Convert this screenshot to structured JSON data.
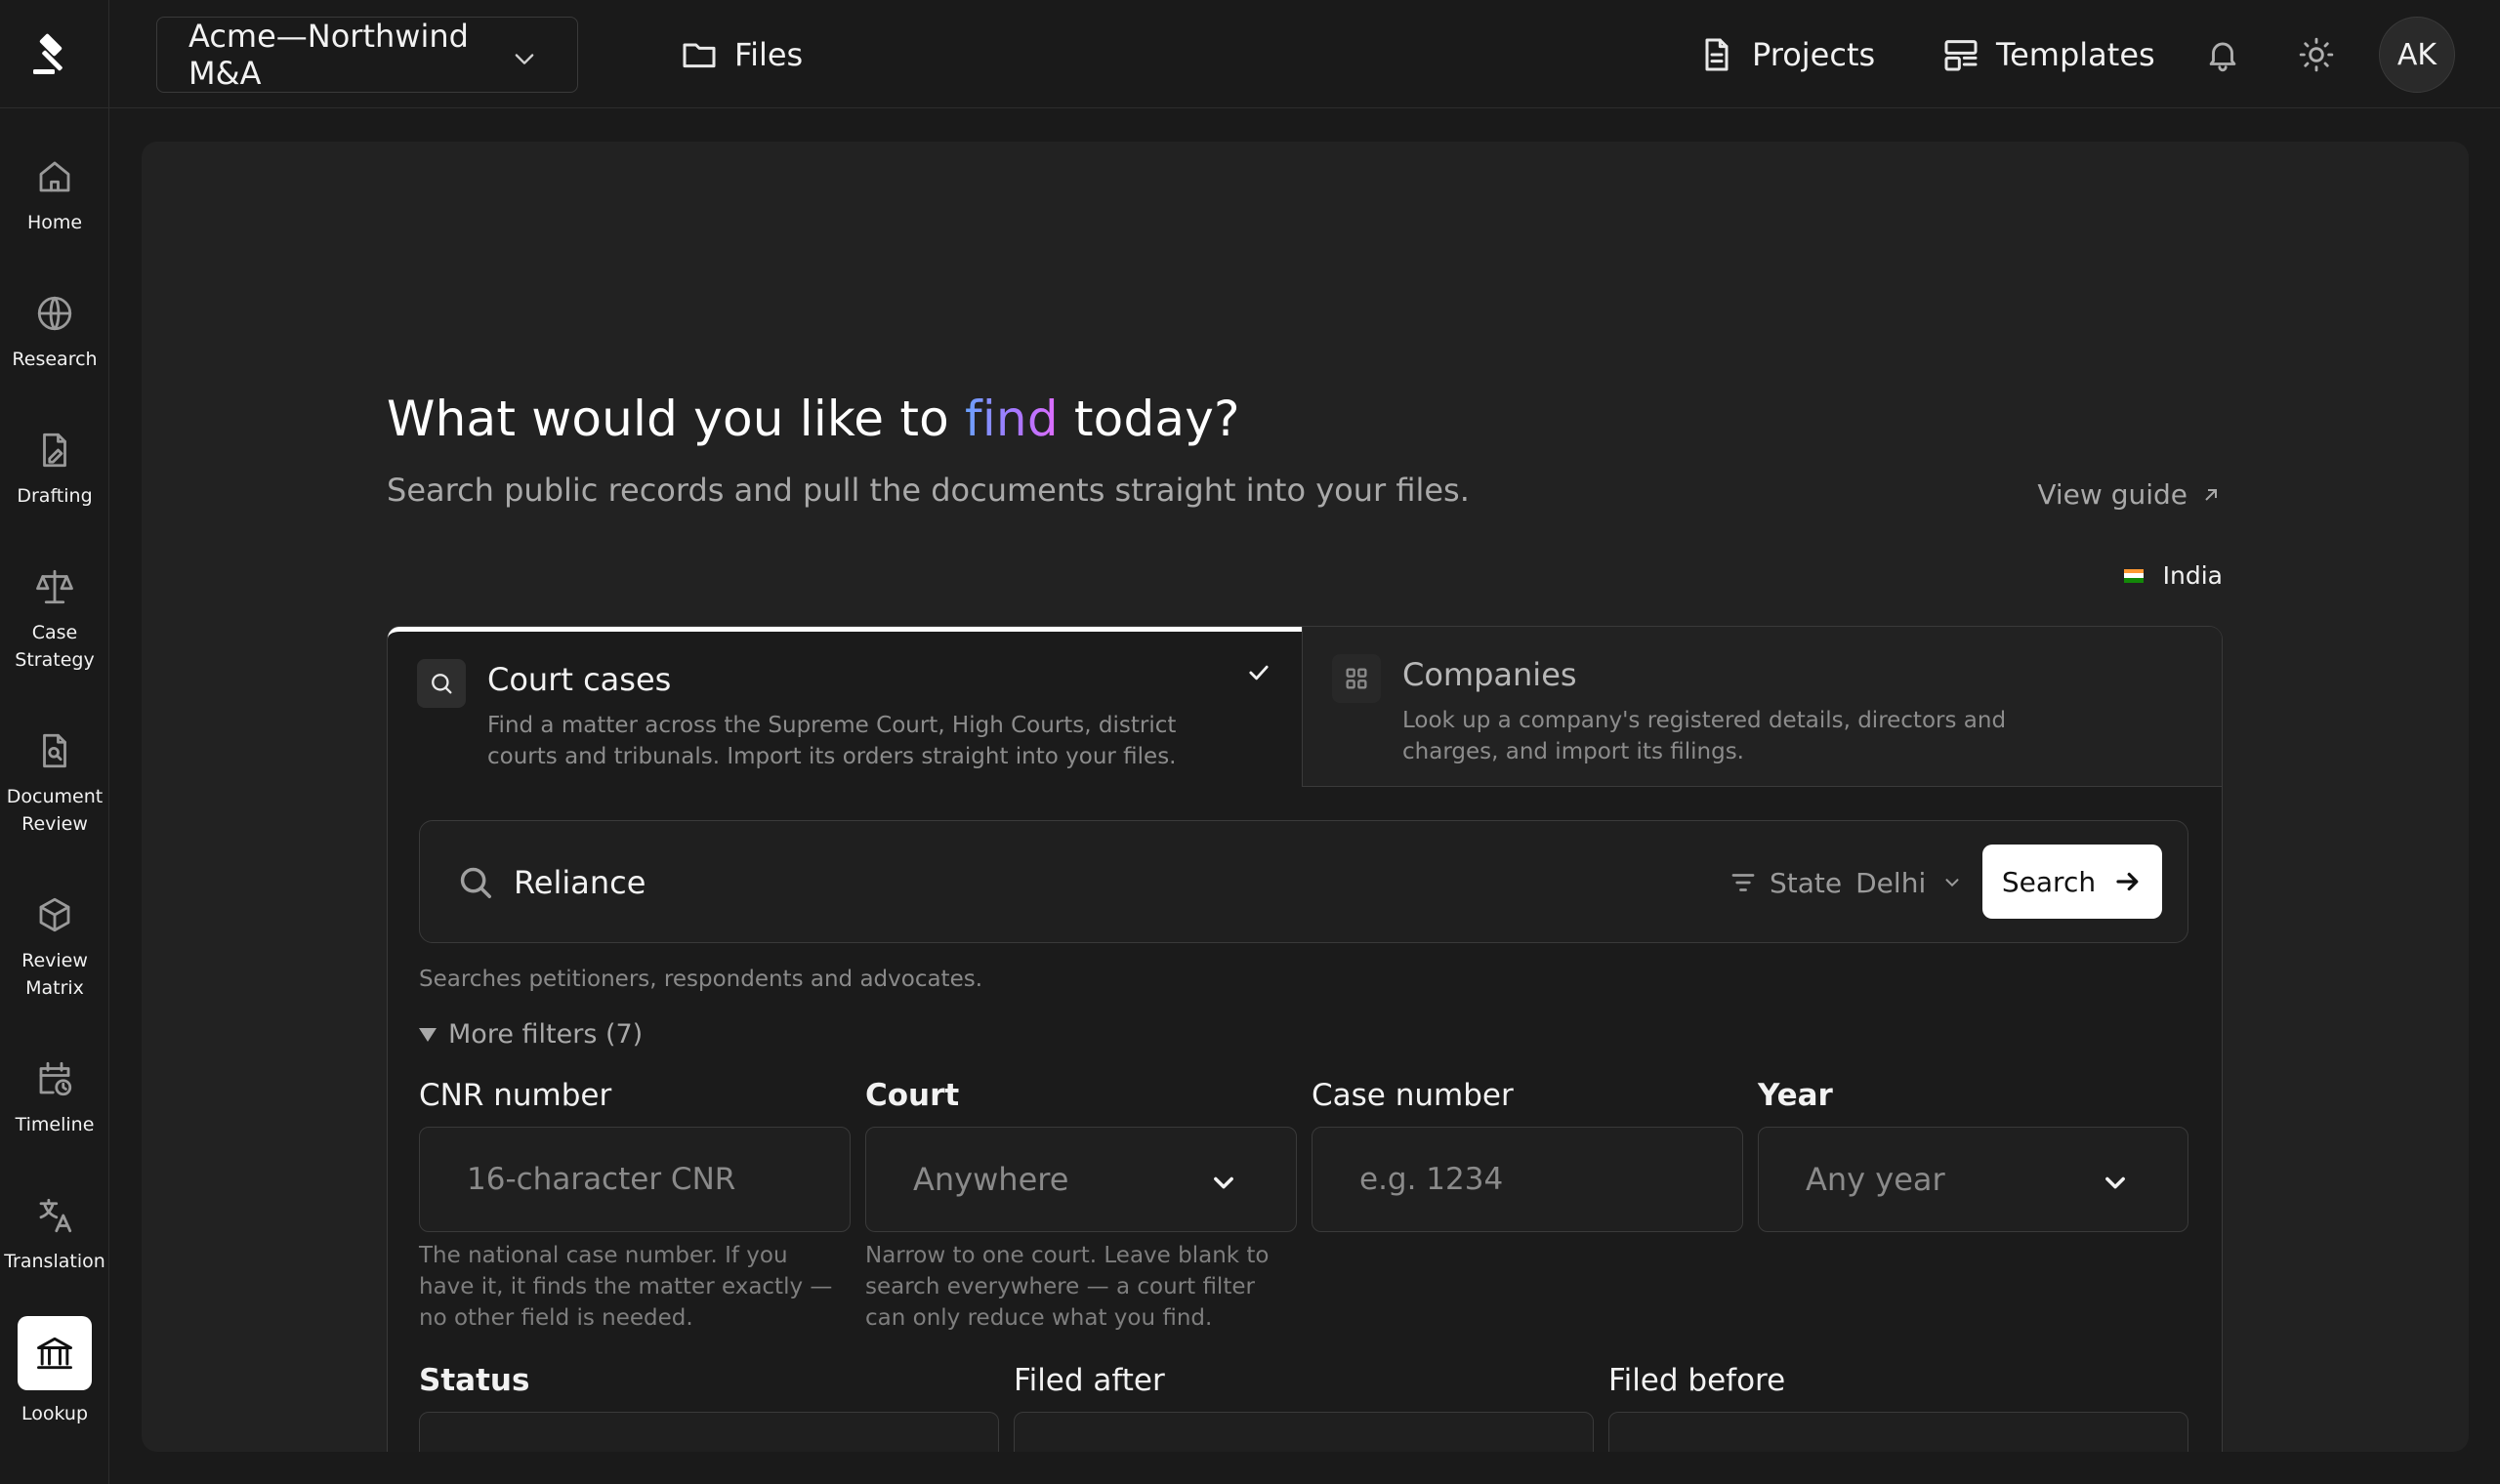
{
  "topbar": {
    "workspace": "Acme—Northwind M&A",
    "files_label": "Files",
    "projects_label": "Projects",
    "templates_label": "Templates",
    "avatar_initials": "AK"
  },
  "sidebar": {
    "items": [
      {
        "label": "Home",
        "icon": "home-icon"
      },
      {
        "label": "Research",
        "icon": "globe-icon"
      },
      {
        "label": "Drafting",
        "icon": "pen-document-icon"
      },
      {
        "label": "Case Strategy",
        "icon": "scales-icon"
      },
      {
        "label": "Document Review",
        "icon": "document-search-icon"
      },
      {
        "label": "Review Matrix",
        "icon": "cube-icon"
      },
      {
        "label": "Timeline",
        "icon": "calendar-clock-icon"
      },
      {
        "label": "Translation",
        "icon": "translate-icon"
      },
      {
        "label": "Lookup",
        "icon": "bank-icon",
        "active": true
      }
    ]
  },
  "main": {
    "headline_before": "What would you like to",
    "headline_accent": "find",
    "headline_after": "today?",
    "subline": "Search public records and pull the documents straight into your files.",
    "guide_label": "View guide",
    "country": "India",
    "tabs": [
      {
        "title": "Court cases",
        "desc": "Find a matter across the Supreme Court, High Courts, district courts and tribunals. Import its orders straight into your files.",
        "selected": true
      },
      {
        "title": "Companies",
        "desc": "Look up a company's registered details, directors and charges, and import its filings.",
        "selected": false
      }
    ],
    "search": {
      "value": "Reliance",
      "state_label": "State",
      "state_value": "Delhi",
      "button_label": "Search",
      "hint": "Searches petitioners, respondents and advocates."
    },
    "more_filters_label": "More filters (7)",
    "filters": {
      "cnr": {
        "label": "CNR number",
        "placeholder": "16-character CNR",
        "help": "The national case number. If you have it, it finds the matter exactly — no other field is needed."
      },
      "court": {
        "label": "Court",
        "value": "Anywhere",
        "help": "Narrow to one court. Leave blank to search everywhere — a court filter can only reduce what you find."
      },
      "case_number": {
        "label": "Case number",
        "placeholder": "e.g. 1234"
      },
      "year": {
        "label": "Year",
        "value": "Any year"
      },
      "status": {
        "label": "Status"
      },
      "filed_after": {
        "label": "Filed after"
      },
      "filed_before": {
        "label": "Filed before"
      }
    }
  },
  "colors": {
    "background": "#1a1a1a",
    "panel": "#222222",
    "accent_gradient_start": "#6aa2ff",
    "accent_gradient_end": "#e06cff",
    "flag_saffron": "#ff9933",
    "flag_white": "#ffffff",
    "flag_green": "#138808"
  }
}
